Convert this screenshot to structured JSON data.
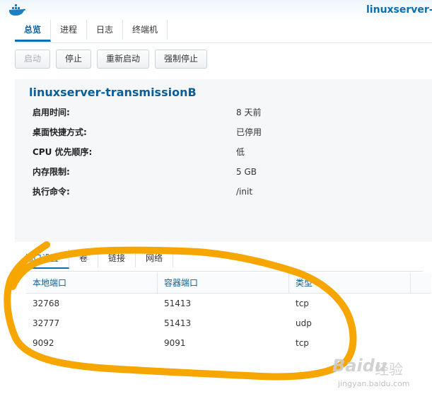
{
  "window": {
    "title": "linuxserver-t"
  },
  "top_tabs": [
    {
      "label": "总览",
      "active": true
    },
    {
      "label": "进程"
    },
    {
      "label": "日志"
    },
    {
      "label": "终端机"
    }
  ],
  "toolbar": {
    "start_label": "启动",
    "stop_label": "停止",
    "restart_label": "重新启动",
    "force_stop_label": "强制停止"
  },
  "details": {
    "container_name": "linuxserver-transmissionB",
    "rows": [
      {
        "label": "启用时间:",
        "value": "8 天前"
      },
      {
        "label": "桌面快捷方式:",
        "value": "已停用"
      },
      {
        "label": "CPU 优先顺序:",
        "value": "低"
      },
      {
        "label": "内存限制:",
        "value": "5 GB"
      },
      {
        "label": "执行命令:",
        "value": "/init"
      }
    ]
  },
  "sub_tabs": [
    {
      "label": "端口设置",
      "active": true
    },
    {
      "label": "卷"
    },
    {
      "label": "链接"
    },
    {
      "label": "网络"
    }
  ],
  "ports_table": {
    "headers": [
      "本地端口",
      "容器端口",
      "类型"
    ],
    "rows": [
      [
        "32768",
        "51413",
        "tcp"
      ],
      [
        "32777",
        "51413",
        "udp"
      ],
      [
        "9092",
        "9091",
        "tcp"
      ]
    ]
  },
  "watermark": {
    "brand": "Baidu",
    "product": "经验",
    "url": "jingyan.baidu.com"
  },
  "colors": {
    "accent": "#0a6fb0",
    "annotation": "#f7a600",
    "panel_bg": "#f5f7f9"
  }
}
